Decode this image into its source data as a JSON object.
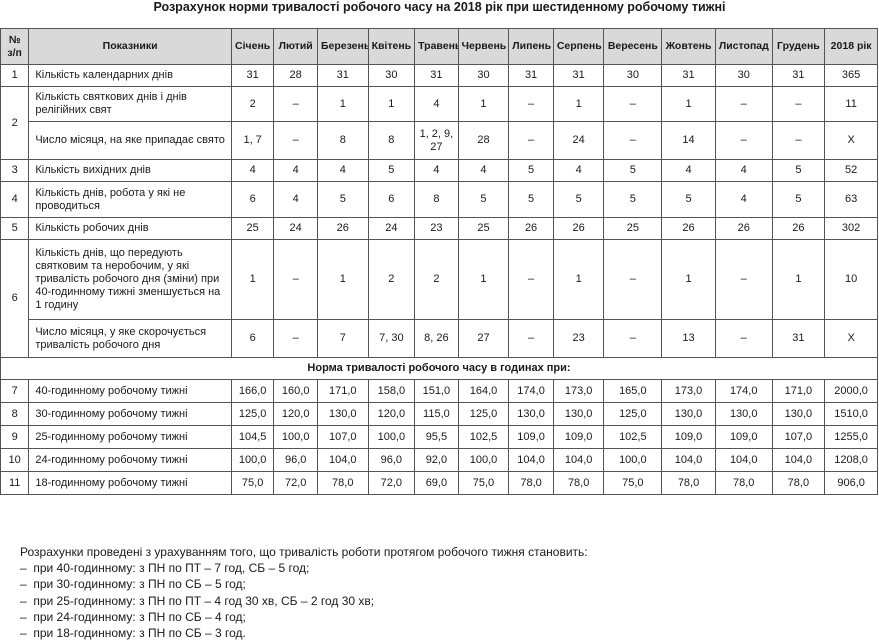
{
  "title": "Розрахунок норми тривалості робочого часу на 2018 рік при шестиденному робочому тижні",
  "headers": {
    "num": [
      "№",
      "з/п"
    ],
    "indicator": "Показники",
    "months": [
      "Січень",
      "Лютий",
      "Березень",
      "Квітень",
      "Травень",
      "Червень",
      "Липень",
      "Серпень",
      "Вересень",
      "Жовтень",
      "Листопад",
      "Грудень"
    ],
    "year": "2018 рік"
  },
  "rows": [
    {
      "num": "1",
      "label": "Кількість календарних днів",
      "values": [
        "31",
        "28",
        "31",
        "30",
        "31",
        "30",
        "31",
        "31",
        "30",
        "31",
        "30",
        "31",
        "365"
      ]
    },
    {
      "num": "2",
      "label": "Кількість святкових днів і днів релігійних свят",
      "values": [
        "2",
        "–",
        "1",
        "1",
        "4",
        "1",
        "–",
        "1",
        "–",
        "1",
        "–",
        "–",
        "11"
      ]
    },
    {
      "num": "",
      "label": "Число місяця, на яке припадає свято",
      "values": [
        "1, 7",
        "–",
        "8",
        "8",
        "1, 2, 9, 27",
        "28",
        "–",
        "24",
        "–",
        "14",
        "–",
        "–",
        "Х"
      ]
    },
    {
      "num": "3",
      "label": "Кількість вихідних днів",
      "values": [
        "4",
        "4",
        "4",
        "5",
        "4",
        "4",
        "5",
        "4",
        "5",
        "4",
        "4",
        "5",
        "52"
      ]
    },
    {
      "num": "4",
      "label": "Кількість днів, робота у які не проводиться",
      "values": [
        "6",
        "4",
        "5",
        "6",
        "8",
        "5",
        "5",
        "5",
        "5",
        "5",
        "4",
        "5",
        "63"
      ]
    },
    {
      "num": "5",
      "label": "Кількість робочих днів",
      "values": [
        "25",
        "24",
        "26",
        "24",
        "23",
        "25",
        "26",
        "26",
        "25",
        "26",
        "26",
        "26",
        "302"
      ]
    },
    {
      "num": "6",
      "label": "Кількість днів, що передують святковим та неробочим, у які тривалість робочого дня (зміни) при 40-годинному тижні зменшується на 1 годину",
      "values": [
        "1",
        "–",
        "1",
        "2",
        "2",
        "1",
        "–",
        "1",
        "–",
        "1",
        "–",
        "1",
        "10"
      ]
    },
    {
      "num": "",
      "label": "Число місяця, у яке скорочується тривалість робочого дня",
      "values": [
        "6",
        "–",
        "7",
        "7, 30",
        "8, 26",
        "27",
        "–",
        "23",
        "–",
        "13",
        "–",
        "31",
        "Х"
      ]
    }
  ],
  "section_title": "Норма тривалості робочого часу в годинах при:",
  "hours_rows": [
    {
      "num": "7",
      "label": "40-годинному робочому тижні",
      "values": [
        "166,0",
        "160,0",
        "171,0",
        "158,0",
        "151,0",
        "164,0",
        "174,0",
        "173,0",
        "165,0",
        "173,0",
        "174,0",
        "171,0",
        "2000,0"
      ]
    },
    {
      "num": "8",
      "label": "30-годинному робочому тижні",
      "values": [
        "125,0",
        "120,0",
        "130,0",
        "120,0",
        "115,0",
        "125,0",
        "130,0",
        "130,0",
        "125,0",
        "130,0",
        "130,0",
        "130,0",
        "1510,0"
      ]
    },
    {
      "num": "9",
      "label": "25-годинному робочому тижні",
      "values": [
        "104,5",
        "100,0",
        "107,0",
        "100,0",
        "95,5",
        "102,5",
        "109,0",
        "109,0",
        "102,5",
        "109,0",
        "109,0",
        "107,0",
        "1255,0"
      ]
    },
    {
      "num": "10",
      "label": "24-годинному робочому тижні",
      "values": [
        "100,0",
        "96,0",
        "104,0",
        "96,0",
        "92,0",
        "100,0",
        "104,0",
        "104,0",
        "100,0",
        "104,0",
        "104,0",
        "104,0",
        "1208,0"
      ]
    },
    {
      "num": "11",
      "label": "18-годинному робочому тижні",
      "values": [
        "75,0",
        "72,0",
        "78,0",
        "72,0",
        "69,0",
        "75,0",
        "78,0",
        "78,0",
        "75,0",
        "78,0",
        "78,0",
        "78,0",
        "906,0"
      ]
    }
  ],
  "notes": [
    "Розрахунки проведені з урахуванням того, що тривалість роботи протягом робочого тижня становить:",
    "–  при 40-годинному: з ПН по ПТ – 7 год, СБ – 5 год;",
    "–  при 30-годинному: з ПН по СБ – 5 год;",
    "–  при 25-годинному: з ПН по ПТ – 4 год 30 хв, СБ – 2 год 30 хв;",
    "–  при 24-годинному: з ПН по СБ – 4 год;",
    "–  при 18-годинному: з ПН по СБ – 3 год."
  ]
}
